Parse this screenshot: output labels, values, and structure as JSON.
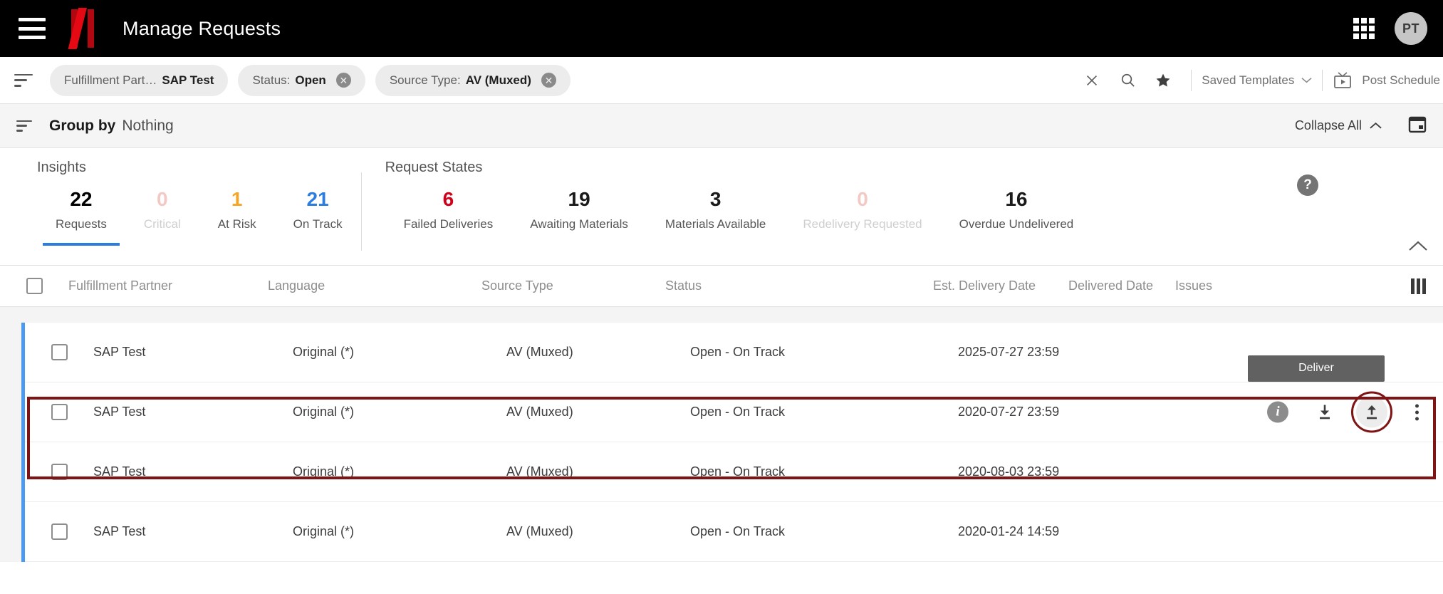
{
  "header": {
    "title": "Manage Requests",
    "menu_icon": "hamburger-icon",
    "logo": "netflix-n-logo",
    "apps_icon": "app-grid-icon",
    "avatar_initials": "PT"
  },
  "filter_bar": {
    "filter_icon": "filter-icon",
    "chips": [
      {
        "key": "Fulfillment Part…",
        "value": "SAP Test",
        "removable": false
      },
      {
        "key": "Status:",
        "value": "Open",
        "removable": true
      },
      {
        "key": "Source Type:",
        "value": "AV (Muxed)",
        "removable": true
      }
    ],
    "clear_icon": "close-icon",
    "search_icon": "search-icon",
    "favorite_icon": "star-icon",
    "saved_templates_label": "Saved Templates",
    "post_schedule_label": "Post Schedule",
    "post_schedule_icon": "tv-icon"
  },
  "group_bar": {
    "group_icon": "sort-icon",
    "label": "Group by",
    "value": "Nothing",
    "collapse_all_label": "Collapse All",
    "calendar_icon": "calendar-icon"
  },
  "insights": {
    "help_icon": "help-icon",
    "collapse_icon": "chevron-up-icon",
    "groups": [
      {
        "title": "Insights",
        "cells": [
          {
            "value": "22",
            "label": "Requests",
            "color": "#1a1a1a",
            "active": true,
            "dim": false
          },
          {
            "value": "0",
            "label": "Critical",
            "color": "#f3c9c6",
            "active": false,
            "dim": true
          },
          {
            "value": "1",
            "label": "At Risk",
            "color": "#f5a623",
            "active": false,
            "dim": false
          },
          {
            "value": "21",
            "label": "On Track",
            "color": "#2b7ee0",
            "active": false,
            "dim": false
          }
        ]
      },
      {
        "title": "Request States",
        "cells": [
          {
            "value": "6",
            "label": "Failed Deliveries",
            "color": "#d0021b",
            "active": false,
            "dim": false
          },
          {
            "value": "19",
            "label": "Awaiting Materials",
            "color": "#1a1a1a",
            "active": false,
            "dim": false
          },
          {
            "value": "3",
            "label": "Materials Available",
            "color": "#1a1a1a",
            "active": false,
            "dim": false
          },
          {
            "value": "0",
            "label": "Redelivery Requested",
            "color": "#f3c9c6",
            "active": false,
            "dim": true
          },
          {
            "value": "16",
            "label": "Overdue Undelivered",
            "color": "#1a1a1a",
            "active": false,
            "dim": false
          }
        ]
      }
    ]
  },
  "table": {
    "columns": [
      "Fulfillment Partner",
      "Language",
      "Source Type",
      "Status",
      "Est. Delivery Date",
      "Delivered Date",
      "Issues"
    ],
    "columns_icon": "columns-icon",
    "rows": [
      {
        "partner": "SAP Test",
        "language": "Original (*)",
        "source_type": "AV (Muxed)",
        "status": "Open - On Track",
        "est_delivery_date": "2025-07-27 23:59",
        "delivered_date": "",
        "issues": "",
        "show_actions": false,
        "highlighted": false
      },
      {
        "partner": "SAP Test",
        "language": "Original (*)",
        "source_type": "AV (Muxed)",
        "status": "Open - On Track",
        "est_delivery_date": "2020-07-27 23:59",
        "delivered_date": "",
        "issues": "",
        "show_actions": true,
        "highlighted": true
      },
      {
        "partner": "SAP Test",
        "language": "Original (*)",
        "source_type": "AV (Muxed)",
        "status": "Open - On Track",
        "est_delivery_date": "2020-08-03 23:59",
        "delivered_date": "",
        "issues": "",
        "show_actions": false,
        "highlighted": false
      },
      {
        "partner": "SAP Test",
        "language": "Original (*)",
        "source_type": "AV (Muxed)",
        "status": "Open - On Track",
        "est_delivery_date": "2020-01-24 14:59",
        "delivered_date": "",
        "issues": "",
        "show_actions": false,
        "highlighted": false
      }
    ],
    "row_actions": {
      "info_icon": "info-icon",
      "download_icon": "download-icon",
      "deliver_icon": "upload-icon",
      "more_icon": "more-vertical-icon"
    }
  },
  "tooltip": {
    "text": "Deliver"
  },
  "colors": {
    "brand_red": "#e50914",
    "accent_blue": "#2b7ee0",
    "row_accent": "#4a9bf0",
    "highlight": "#7e1414",
    "warn_orange": "#f5a623",
    "error_red": "#d0021b"
  }
}
